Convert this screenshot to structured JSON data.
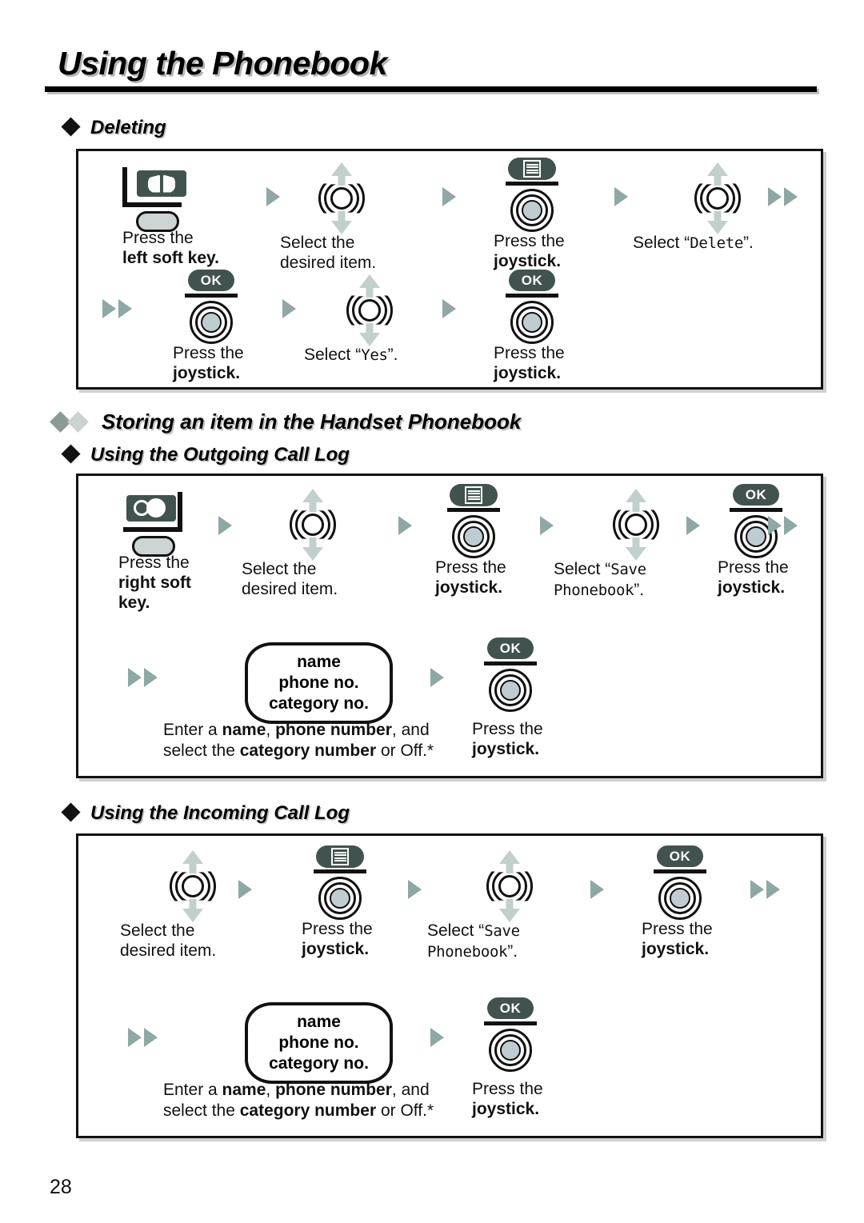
{
  "page": {
    "title": "Using the Phonebook",
    "number": "28"
  },
  "sections": [
    {
      "id": "deleting",
      "heading": "Deleting",
      "marker": "black-diamond",
      "steps": [
        {
          "icon": "left-soft-key-phonebook",
          "line1": "Press the",
          "line2": "left soft key.",
          "line2_bold": true
        },
        {
          "icon": "select-joystick",
          "line1": "Select the",
          "line2": "desired item."
        },
        {
          "icon": "press-joystick-menu",
          "line1": "Press the",
          "line2": "joystick.",
          "line2_bold": true
        },
        {
          "icon": "select-joystick",
          "line1": "Select “Delete”.",
          "mono_word": "Delete"
        },
        {
          "icon": "press-joystick-ok",
          "line1": "Press the",
          "line2": "joystick.",
          "line2_bold": true
        },
        {
          "icon": "select-joystick",
          "line1": "Select “Yes”.",
          "mono_word": "Yes"
        },
        {
          "icon": "press-joystick-ok",
          "line1": "Press the",
          "line2": "joystick.",
          "line2_bold": true
        }
      ]
    },
    {
      "id": "storing",
      "heading": "Storing an item in the Handset Phonebook",
      "marker": "double-diamond",
      "subheading": "Using the Outgoing Call Log",
      "steps": [
        {
          "icon": "right-soft-key-calllog",
          "line1": "Press the",
          "line2": "right soft",
          "line3": "key."
        },
        {
          "icon": "select-joystick",
          "line1": "Select the",
          "line2": "desired item."
        },
        {
          "icon": "press-joystick-menu",
          "line1": "Press the",
          "line2": "joystick."
        },
        {
          "icon": "select-joystick",
          "line1": "Select “Save",
          "line2": "Phonebook”.",
          "mono": true
        },
        {
          "icon": "press-joystick-ok",
          "line1": "Press the",
          "line2": "joystick."
        },
        {
          "icon": "entry-box",
          "box_lines": [
            "name",
            "phone no.",
            "category no."
          ],
          "line1": "Enter a name, phone number, and",
          "line2": "select the category number or Off.*"
        },
        {
          "icon": "press-joystick-ok",
          "line1": "Press the",
          "line2": "joystick."
        }
      ]
    },
    {
      "id": "incoming",
      "subheading": "Using the Incoming Call Log",
      "marker": "black-diamond",
      "steps": [
        {
          "icon": "select-joystick",
          "line1": "Select the",
          "line2": "desired item."
        },
        {
          "icon": "press-joystick-menu",
          "line1": "Press the",
          "line2": "joystick."
        },
        {
          "icon": "select-joystick",
          "line1": "Select “Save",
          "line2": "Phonebook”.",
          "mono": true
        },
        {
          "icon": "press-joystick-ok",
          "line1": "Press the",
          "line2": "joystick."
        },
        {
          "icon": "entry-box",
          "box_lines": [
            "name",
            "phone no.",
            "category no."
          ],
          "line1": "Enter a name, phone number, and",
          "line2": "select the category number or Off.*"
        },
        {
          "icon": "press-joystick-ok",
          "line1": "Press the",
          "line2": "joystick."
        }
      ]
    }
  ],
  "labels": {
    "press_the": "Press the",
    "select_the": "Select the",
    "desired_item": "desired item.",
    "joystick": "joystick.",
    "left_soft_key": "left soft key.",
    "right_soft": "right soft",
    "key": "key.",
    "select_open": "Select “",
    "quote_close": "”.",
    "delete": "Delete",
    "yes": "Yes",
    "save": "Save",
    "phonebook": "Phonebook",
    "ok": "OK",
    "box_name": "name",
    "box_phone": "phone no.",
    "box_category": "category no.",
    "enter_a": "Enter a ",
    "name_b": "name",
    "comma_space": ", ",
    "phone_number_b": "phone number",
    "and_tail": ", and",
    "select_the2": "select the ",
    "category_number_b": "category number",
    "or_off": " or Off.*"
  },
  "colors": {
    "icon_dark": "#42534f",
    "arrow": "#8fa8a5",
    "joy_arrow": "#c2d0cd",
    "pill_fill": "#ccd4d4",
    "center_fill": "#bfcdd2",
    "ink": "#111111"
  }
}
